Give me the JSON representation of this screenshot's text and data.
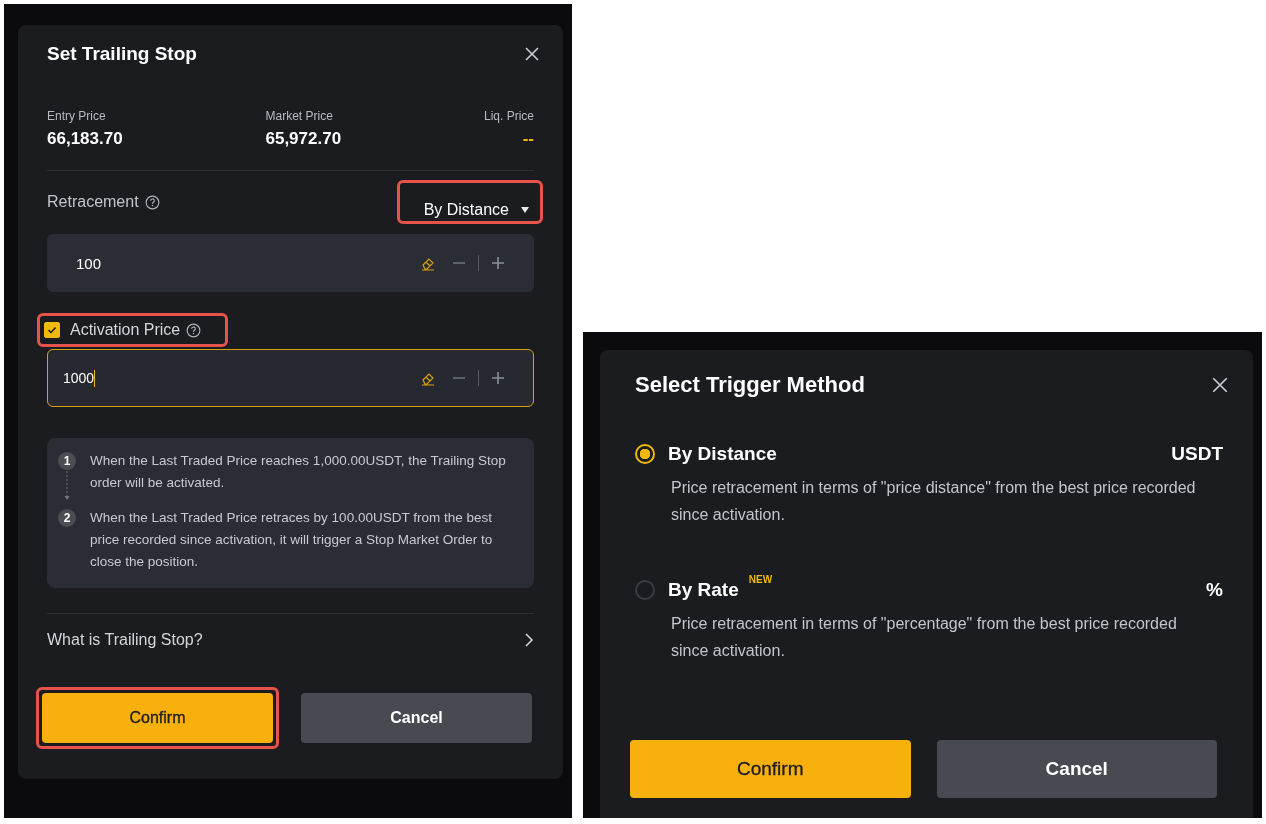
{
  "trailing_stop_dialog": {
    "title": "Set Trailing Stop",
    "prices": [
      {
        "label": "Entry Price",
        "value": "66,183.70",
        "kind": "value"
      },
      {
        "label": "Market Price",
        "value": "65,972.70",
        "kind": "value"
      },
      {
        "label": "Liq. Price",
        "value": "--",
        "kind": "empty"
      }
    ],
    "retracement": {
      "label": "Retracement",
      "mode": {
        "label": "By Distance",
        "highlighted": true
      },
      "value": "100"
    },
    "activation": {
      "label": "Activation Price",
      "checked": true,
      "highlighted": true,
      "value": "1000",
      "focused": true
    },
    "steps": [
      {
        "number": "1",
        "text": "When the Last Traded Price reaches 1,000.00USDT, the Trailing Stop order will be activated."
      },
      {
        "number": "2",
        "text": "When the Last Traded Price retraces by 100.00USDT from the best price recorded since activation, it will trigger a Stop Market Order to close the position."
      }
    ],
    "help_link": "What is Trailing Stop?",
    "buttons": [
      {
        "label": "Confirm",
        "kind": "primary",
        "highlighted": true
      },
      {
        "label": "Cancel",
        "kind": "secondary",
        "highlighted": false
      }
    ]
  },
  "trigger_method_dialog": {
    "title": "Select Trigger Method",
    "options": [
      {
        "label": "By Distance",
        "unit": "USDT",
        "description": "Price retracement in terms of \"price distance\" from the best price recorded since activation.",
        "selected": true
      },
      {
        "label": "By Rate",
        "badge": "NEW",
        "unit": "%",
        "description": "Price retracement in terms of \"percentage\" from the best price recorded since activation.",
        "selected": false
      }
    ],
    "buttons": [
      {
        "label": "Confirm",
        "kind": "primary"
      },
      {
        "label": "Cancel",
        "kind": "secondary"
      }
    ]
  }
}
